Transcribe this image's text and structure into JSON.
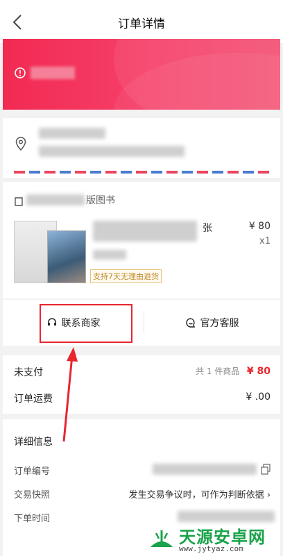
{
  "header": {
    "title": "订单详情"
  },
  "shop": {
    "name_fragment": "版图书",
    "chevron": "›"
  },
  "product": {
    "name_fragment": "张",
    "price": "¥  80",
    "quantity": "x1",
    "service_tag": "支持7天无理由退货"
  },
  "actions": {
    "contact_merchant": "联系商家",
    "official_service": "官方客服"
  },
  "payment": {
    "unpaid_label": "未支付",
    "item_count": "共 1 件商品",
    "unpaid_amount": "¥    80",
    "shipping_label": "订单运费",
    "shipping_amount": "¥     .00"
  },
  "detail": {
    "title": "详细信息",
    "order_no_label": "订单编号",
    "snapshot_label": "交易快照",
    "snapshot_value": "发生交易争议时，可作为判断依据 ›",
    "order_time_label": "下单时间"
  },
  "watermark": {
    "text": "天源安卓网",
    "url": "www.jytyaz.com"
  },
  "colors": {
    "banner": "#f22a52",
    "highlight": "#e8262e",
    "watermark": "#1aa34a"
  }
}
